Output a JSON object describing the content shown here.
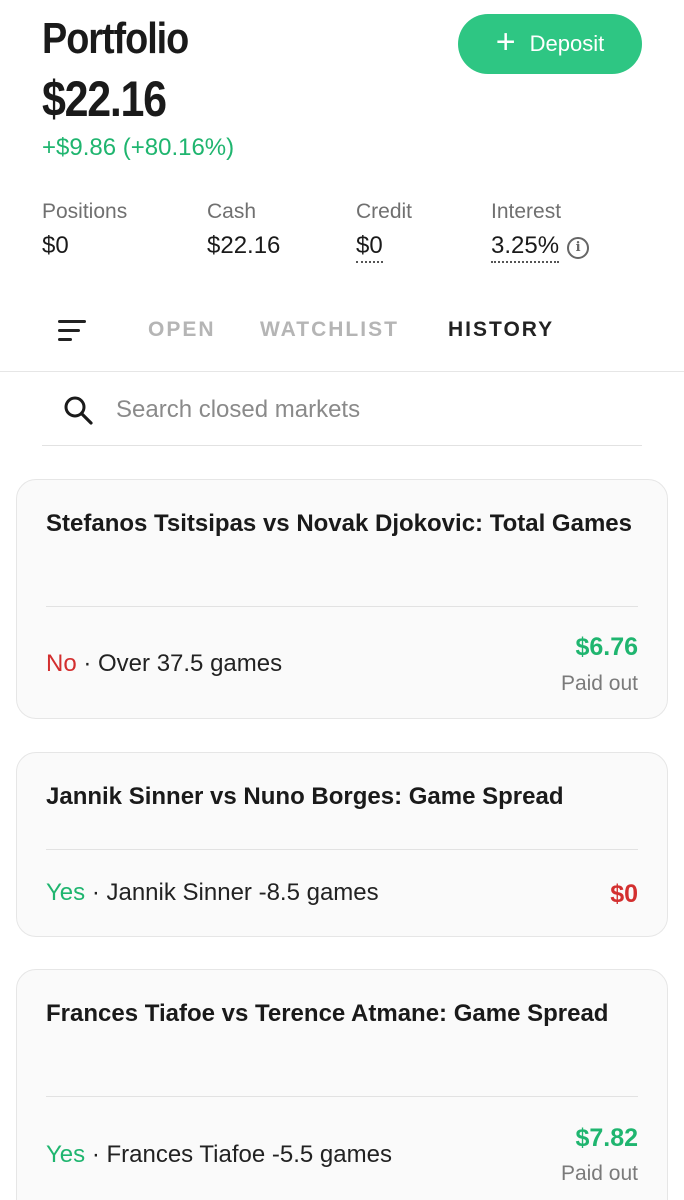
{
  "header": {
    "title": "Portfolio",
    "balance": "$22.16",
    "change": "+$9.86 (+80.16%)",
    "deposit_label": "Deposit"
  },
  "stats": [
    {
      "label": "Positions",
      "value": "$0"
    },
    {
      "label": "Cash",
      "value": "$22.16"
    },
    {
      "label": "Credit",
      "value": "$0"
    },
    {
      "label": "Interest",
      "value": "3.25%"
    }
  ],
  "tabs": [
    {
      "label": "OPEN",
      "active": false
    },
    {
      "label": "WATCHLIST",
      "active": false
    },
    {
      "label": "HISTORY",
      "active": true
    }
  ],
  "search": {
    "placeholder": "Search closed markets"
  },
  "cards": [
    {
      "title": "Stefanos Tsitsipas vs Novak Djokovic: Total Games",
      "side": "No",
      "separator": " · ",
      "position": "Over 37.5 games",
      "amount": "$6.76",
      "status": "Paid out"
    },
    {
      "title": "Jannik Sinner vs Nuno Borges: Game Spread",
      "side": "Yes",
      "separator": " · ",
      "position": "Jannik Sinner -8.5 games",
      "amount": "$0",
      "status": ""
    },
    {
      "title": "Frances Tiafoe vs Terence Atmane: Game Spread",
      "side": "Yes",
      "separator": " · ",
      "position": "Frances Tiafoe -5.5 games",
      "amount": "$7.82",
      "status": "Paid out"
    }
  ],
  "colors": {
    "accent_green": "#2ec683",
    "positive": "#1fb56f",
    "negative": "#d32f2f"
  }
}
